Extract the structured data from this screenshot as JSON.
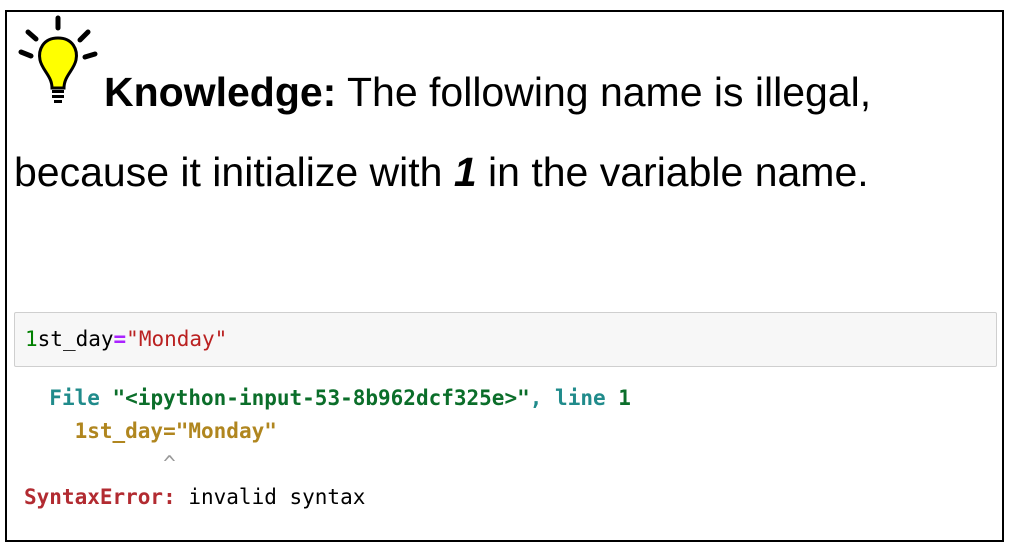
{
  "knowledge": {
    "label": "Knowledge:",
    "text_before": " The following name is illegal, because it initialize with ",
    "emphasis": "1",
    "text_after": " in the variable name."
  },
  "code_cell": {
    "digit": "1",
    "name": "st_day",
    "operator": "=",
    "string": "\"Monday\""
  },
  "output": {
    "file_kw": "File ",
    "file_name": "\"<ipython-input-53-8b962dcf325e>\"",
    "comma": ", ",
    "line_kw": "line ",
    "line_no": "1",
    "source": "1st_day=\"Monday\"",
    "caret": "^",
    "error_type": "SyntaxError:",
    "error_msg": " invalid syntax"
  },
  "colors": {
    "bulb": "#ffff00",
    "code_bg": "#f7f7f7",
    "error": "#b22b31"
  }
}
